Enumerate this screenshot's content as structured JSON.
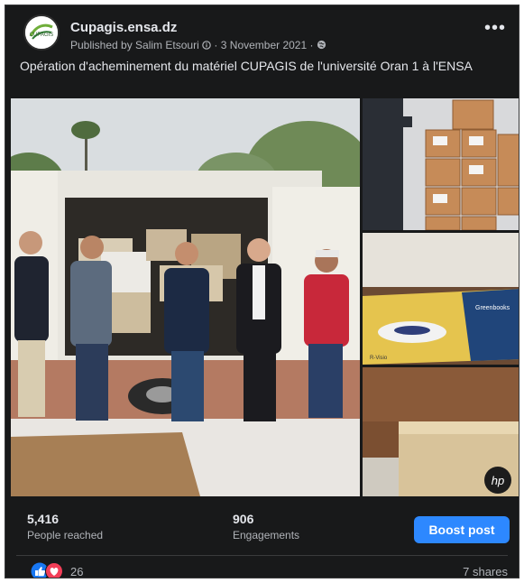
{
  "post": {
    "page_name": "Cupagis.ensa.dz",
    "published_by": "Published by Salim Etsouri",
    "date": "3 November 2021",
    "caption": "Opération d'acheminement du matériel CUPAGIS de l'université Oran 1 à l'ENSA",
    "more_label": "•••"
  },
  "stats": {
    "reached_value": "5,416",
    "reached_label": "People reached",
    "engagements_value": "906",
    "engagements_label": "Engagements",
    "boost_label": "Boost post"
  },
  "footer": {
    "reaction_count": "26",
    "shares": "7 shares"
  },
  "images": {
    "box_brand_label": "Greenbooks",
    "box_text": "R-Visio",
    "hp_logo": "hp"
  },
  "colors": {
    "background": "#18191a",
    "text_primary": "#e4e6eb",
    "text_secondary": "#b0b3b8",
    "boost_blue": "#2d88ff",
    "like_blue": "#1877f2",
    "love_red": "#f33e58"
  },
  "icons": [
    "globe-icon",
    "more-icon",
    "like-icon",
    "love-icon",
    "avatar"
  ]
}
